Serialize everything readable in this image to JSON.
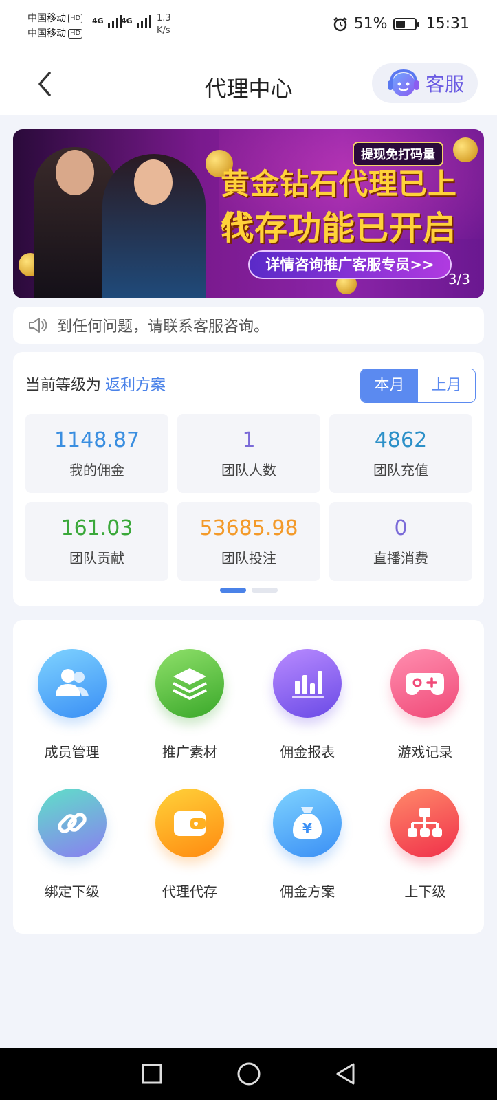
{
  "status_bar": {
    "carrier1": "中国移动",
    "carrier2": "中国移动",
    "hd": "HD",
    "net1": "4G",
    "net2": "4G",
    "speed_value": "1.3",
    "speed_unit": "K/s",
    "battery": "51%",
    "battery_level": 0.51,
    "time": "15:31"
  },
  "header": {
    "title": "代理中心",
    "service_label": "客服"
  },
  "banner": {
    "tag": "提现免打码量",
    "line1": "黄金钻石代理已上线",
    "line2": "代存功能已开启",
    "pill": "详情咨询推广客服专员>>",
    "pager": "3/3"
  },
  "notice": {
    "text": "到任何问题，请联系客服咨询。"
  },
  "stats": {
    "level_label": "当前等级为",
    "level_value": "返利方案",
    "tabs": [
      "本月",
      "上月"
    ],
    "cells": [
      {
        "value": "1148.87",
        "label": "我的佣金",
        "color": "#3a8ee0"
      },
      {
        "value": "1",
        "label": "团队人数",
        "color": "#7a6ad8"
      },
      {
        "value": "4862",
        "label": "团队充值",
        "color": "#2c90c8"
      },
      {
        "value": "161.03",
        "label": "团队贡献",
        "color": "#3aa83a"
      },
      {
        "value": "53685.98",
        "label": "团队投注",
        "color": "#f39a2a"
      },
      {
        "value": "0",
        "label": "直播消费",
        "color": "#7a6ad8"
      }
    ]
  },
  "menu": {
    "items": [
      {
        "label": "成员管理",
        "icon": "members-icon"
      },
      {
        "label": "推广素材",
        "icon": "layers-icon"
      },
      {
        "label": "佣金报表",
        "icon": "bar-chart-icon"
      },
      {
        "label": "游戏记录",
        "icon": "gamepad-icon"
      },
      {
        "label": "绑定下级",
        "icon": "link-icon"
      },
      {
        "label": "代理代存",
        "icon": "wallet-icon"
      },
      {
        "label": "佣金方案",
        "icon": "money-bag-icon"
      },
      {
        "label": "上下级",
        "icon": "hierarchy-icon"
      }
    ]
  },
  "colors": {
    "accent": "#5b8af0",
    "service_purple": "#6a5be2"
  }
}
